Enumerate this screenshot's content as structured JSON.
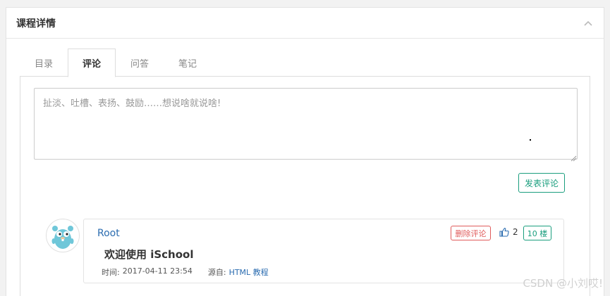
{
  "panel": {
    "title": "课程详情"
  },
  "tabs": [
    {
      "label": "目录",
      "active": false
    },
    {
      "label": "评论",
      "active": true
    },
    {
      "label": "问答",
      "active": false
    },
    {
      "label": "笔记",
      "active": false
    }
  ],
  "comment_form": {
    "placeholder": "扯淡、吐槽、表扬、鼓励……想说啥就说啥!",
    "value": "",
    "submit_label": "发表评论"
  },
  "comment": {
    "user": "Root",
    "text": "欢迎使用 iSchool",
    "time_label": "时间:",
    "time": "2017-04-11 23:54",
    "source_label": "源自:",
    "source": "HTML 教程",
    "delete_label": "删除评论",
    "likes": "2",
    "floor": "10 楼"
  },
  "watermark": "CSDN @小刘哎!",
  "colors": {
    "accent": "#1a9e7e",
    "link": "#2b6cb0",
    "danger": "#e05b5b"
  },
  "icons": {
    "collapse": "chevron-up-icon",
    "like": "thumbs-up-icon",
    "avatar": "gopher-avatar"
  }
}
